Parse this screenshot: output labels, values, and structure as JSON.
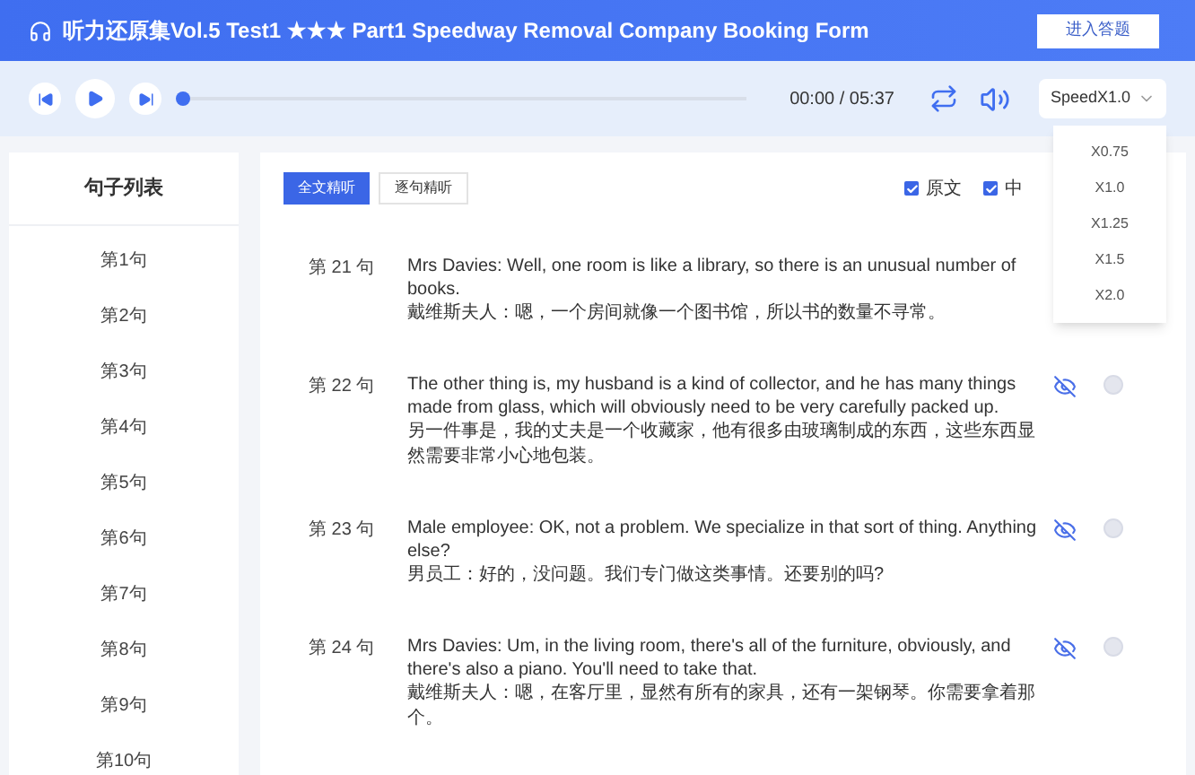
{
  "header": {
    "title": "听力还原集Vol.5 Test1 ★★★ Part1 Speedway Removal Company Booking Form",
    "button": "进入答题"
  },
  "player": {
    "level": 0,
    "time": "00:00 / 05:37",
    "speed": "SpeedX1.0",
    "speed_menu": {
      "expanded": true,
      "options": [
        "X0.75",
        "X1.0",
        "X1.25",
        "X1.5",
        "X2.0"
      ]
    }
  },
  "sidebar": {
    "title": "句子列表",
    "items": [
      {
        "label": "第1句"
      },
      {
        "label": "第2句"
      },
      {
        "label": "第3句"
      },
      {
        "label": "第4句"
      },
      {
        "label": "第5句"
      },
      {
        "label": "第6句"
      },
      {
        "label": "第7句"
      },
      {
        "label": "第8句"
      },
      {
        "label": "第9句"
      },
      {
        "label": "第10句"
      }
    ]
  },
  "modes": [
    {
      "label": "全文精听",
      "selected": true
    },
    {
      "label": "逐句精听",
      "selected": false
    }
  ],
  "toggles": [
    {
      "label": "原文",
      "checked": true
    },
    {
      "label": "中",
      "checked": true
    }
  ],
  "sentences": [
    {
      "number": "第 21 句",
      "english": "Mrs Davies: Well, one room is like a library, so there is an unusual number of books.",
      "chinese": "戴维斯夫人：嗯，一个房间就像一个图书馆，所以书的数量不寻常。"
    },
    {
      "number": "第 22 句",
      "english": "The other thing is, my husband is a kind of collector, and he has many things made from glass, which will obviously need to be very carefully packed up.",
      "chinese": "另一件事是，我的丈夫是一个收藏家，他有很多由玻璃制成的东西，这些东西显然需要非常小心地包装。"
    },
    {
      "number": "第 23 句",
      "english": "Male employee: OK, not a problem. We specialize in that sort of thing. Anything else?",
      "chinese": "男员工：好的，没问题。我们专门做这类事情。还要别的吗?"
    },
    {
      "number": "第 24 句",
      "english": "Mrs Davies: Um, in the living room, there's all of the furniture, obviously, and there's also a piano. You'll need to take that.",
      "chinese": "戴维斯夫人：嗯，在客厅里，显然有所有的家具，还有一架钢琴。你需要拿着那个。"
    }
  ]
}
